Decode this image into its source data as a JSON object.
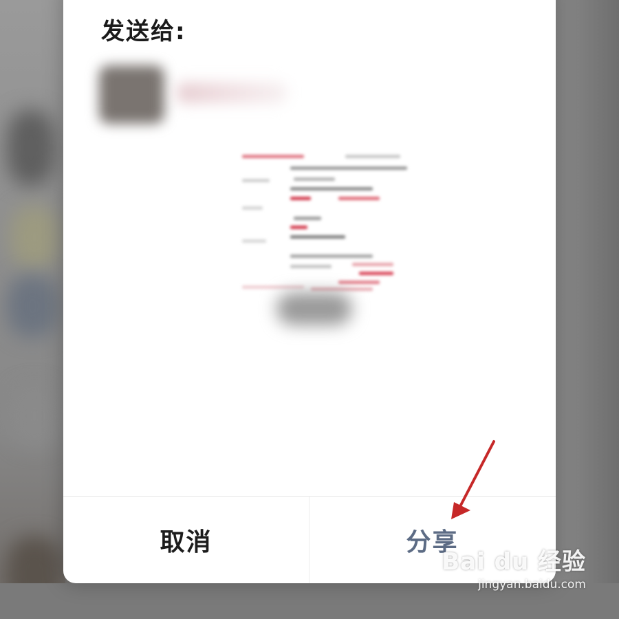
{
  "dialog": {
    "title": "发送给:",
    "cancel_label": "取消",
    "share_label": "分享"
  },
  "colors": {
    "share_accent": "#5c6b84",
    "arrow": "#c62828",
    "dialog_bg": "#ffffff",
    "overlay": "#7f7f7f"
  },
  "watermark": {
    "logo": "Bai du 经验",
    "url": "jingyan.baidu.com"
  },
  "icons": {
    "annotation": "red-arrow-icon",
    "watermark": "baidu-paw-icon"
  }
}
